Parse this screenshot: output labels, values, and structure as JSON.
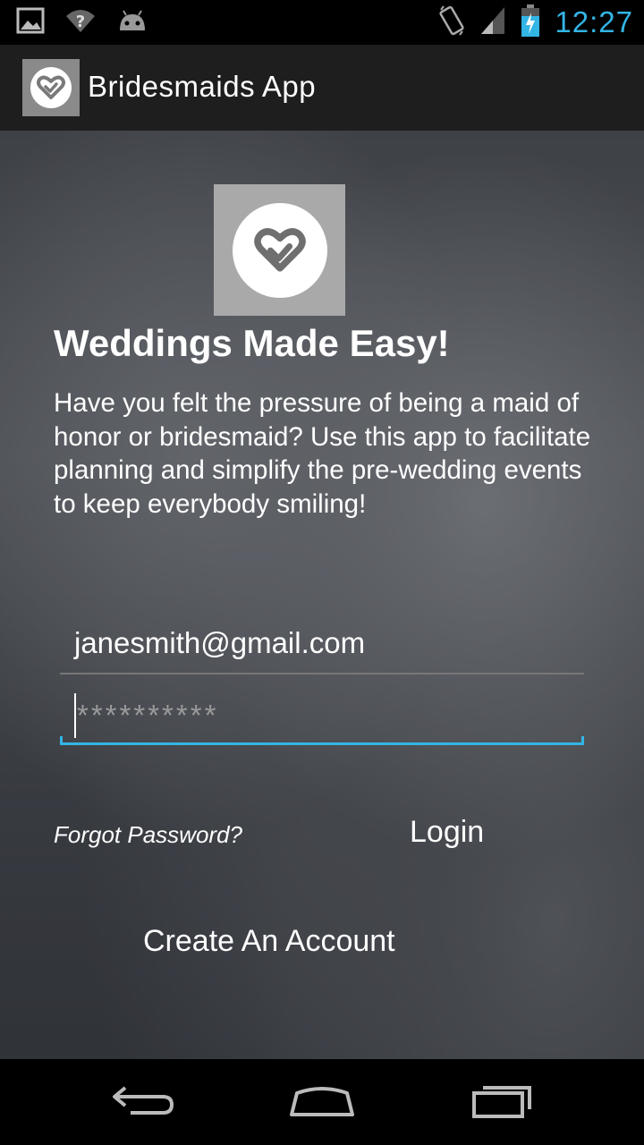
{
  "status_bar": {
    "time": "12:27",
    "icons": [
      "image-icon",
      "wifi-question-icon",
      "android-icon",
      "vibrate-icon",
      "signal-icon",
      "battery-charging-icon"
    ],
    "accent": "#33b5e5"
  },
  "action_bar": {
    "title": "Bridesmaids App",
    "icon": "heart-check-icon"
  },
  "hero": {
    "icon": "heart-check-icon",
    "headline": "Weddings Made Easy!",
    "intro": "Have you felt the pressure of being a maid of honor or bridesmaid? Use this app to facilitate planning and simplify the pre-wedding events to keep everybody smiling!"
  },
  "form": {
    "email_value": "janesmith@gmail.com",
    "password_placeholder": "**********",
    "forgot_label": "Forgot Password?",
    "login_label": "Login",
    "create_label": "Create An Account"
  },
  "nav_bar": {
    "icons": [
      "back-icon",
      "home-icon",
      "recents-icon"
    ]
  }
}
